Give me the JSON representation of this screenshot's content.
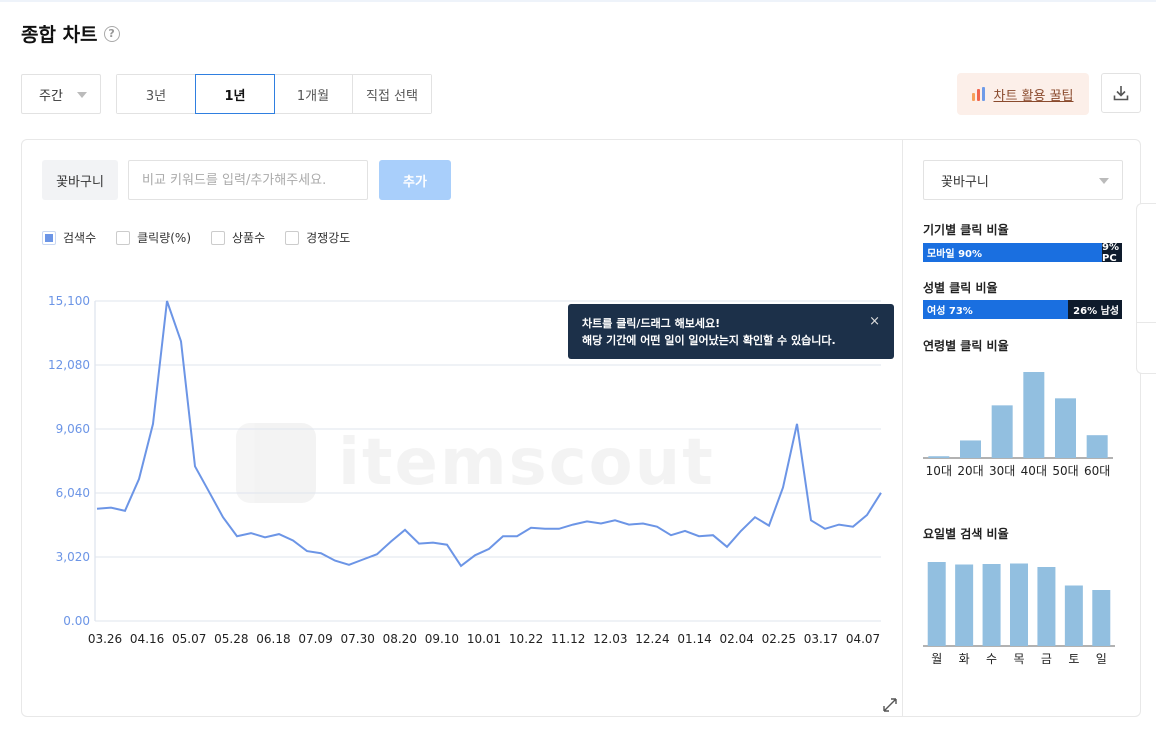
{
  "page": {
    "title": "종합 차트",
    "help_icon": "question-circle-icon"
  },
  "controls": {
    "period_select": "주간",
    "range_tabs": [
      {
        "label": "3년",
        "active": false
      },
      {
        "label": "1년",
        "active": true
      },
      {
        "label": "1개월",
        "active": false
      },
      {
        "label": "직접 선택",
        "active": false
      }
    ],
    "tips_button": "차트 활용 꿀팁",
    "download_icon": "download-icon"
  },
  "keyword": {
    "tag": "꽃바구니",
    "input_placeholder": "비교 키워드를 입력/추가해주세요.",
    "input_value": "",
    "add_button": "추가"
  },
  "legend": [
    {
      "label": "검색수",
      "checked": true
    },
    {
      "label": "클릭량(%)",
      "checked": false
    },
    {
      "label": "상품수",
      "checked": false
    },
    {
      "label": "경쟁강도",
      "checked": false
    }
  ],
  "tooltip": {
    "line1": "차트를 클릭/드래그 해보세요!",
    "line2": "해당 기간에 어떤 일이 일어났는지 확인할 수 있습니다.",
    "close": "×"
  },
  "watermark": "itemscout",
  "chart_data": [
    {
      "type": "line",
      "series": [
        {
          "name": "검색수",
          "color": "#6c95e6"
        }
      ],
      "x_labels": [
        "03.26",
        "04.16",
        "05.07",
        "05.28",
        "06.18",
        "07.09",
        "07.30",
        "08.20",
        "09.10",
        "10.01",
        "10.22",
        "11.12",
        "12.03",
        "12.24",
        "01.14",
        "02.04",
        "02.25",
        "03.17",
        "04.07"
      ],
      "y_ticks": [
        "0.00",
        "3,020",
        "6,040",
        "9,060",
        "12,080",
        "15,100"
      ],
      "ylim": [
        0,
        15100
      ],
      "values": [
        5300,
        5350,
        5200,
        6700,
        9300,
        15100,
        13200,
        7300,
        6100,
        4900,
        4000,
        4150,
        3950,
        4100,
        3800,
        3300,
        3200,
        2850,
        2650,
        2900,
        3150,
        3750,
        4300,
        3650,
        3700,
        3600,
        2600,
        3100,
        3400,
        4000,
        4000,
        4400,
        4350,
        4350,
        4550,
        4700,
        4600,
        4750,
        4550,
        4600,
        4450,
        4050,
        4250,
        4000,
        4050,
        3500,
        4250,
        4900,
        4500,
        6300,
        9300,
        4750,
        4350,
        4550,
        4450,
        5000,
        6050
      ],
      "grid": true
    },
    {
      "type": "bar",
      "title": "연령별 클릭 비율",
      "categories": [
        "10대",
        "20대",
        "30대",
        "40대",
        "50대",
        "60대"
      ],
      "values": [
        1,
        10,
        30,
        49,
        34,
        13
      ],
      "color": "#92bfe0"
    },
    {
      "type": "bar",
      "title": "요일별 검색 비율",
      "categories": [
        "월",
        "화",
        "수",
        "목",
        "금",
        "토",
        "일"
      ],
      "values": [
        16.8,
        16.3,
        16.4,
        16.5,
        15.8,
        12.1,
        11.2
      ],
      "color": "#92bfe0"
    }
  ],
  "sidebar": {
    "select": "꽃바구니",
    "device": {
      "title": "기기별 클릭 비율",
      "a_label": "모바일 90%",
      "a_value": 90,
      "b_label": "9% PC",
      "b_value": 9
    },
    "gender": {
      "title": "성별 클릭 비율",
      "a_label": "여성 73%",
      "a_value": 73,
      "b_label": "26% 남성",
      "b_value": 26
    }
  }
}
